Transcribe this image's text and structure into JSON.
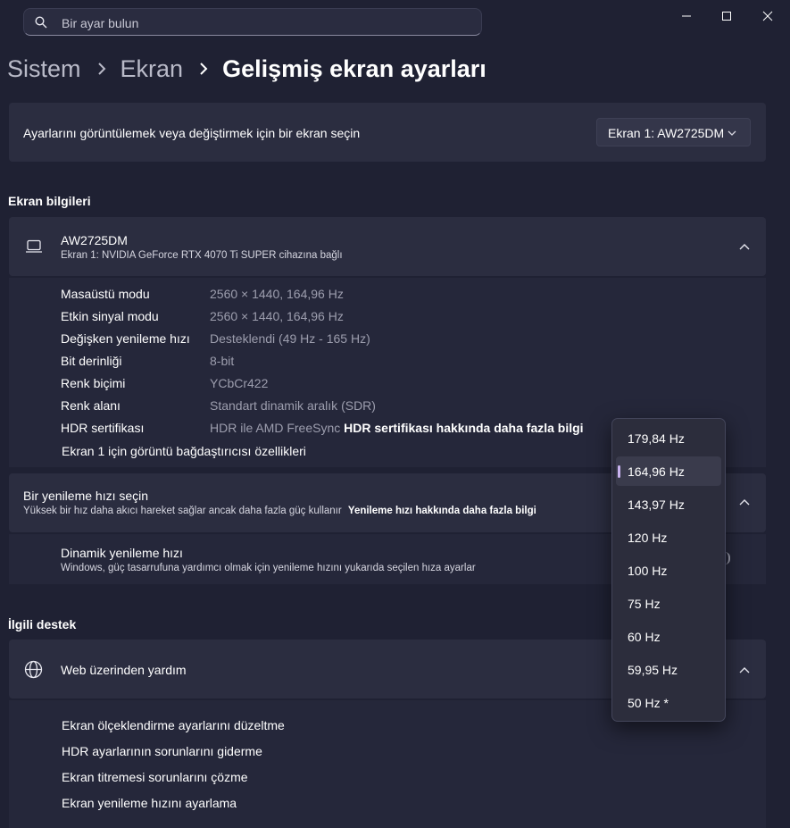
{
  "search": {
    "placeholder": "Bir ayar bulun"
  },
  "breadcrumb": {
    "item1": "Sistem",
    "item2": "Ekran",
    "current": "Gelişmiş ekran ayarları"
  },
  "display_select": {
    "prompt": "Ayarlarını görüntülemek veya değiştirmek için bir ekran seçin",
    "selected": "Ekran 1: AW2725DM"
  },
  "display_info": {
    "section_title": "Ekran bilgileri",
    "monitor_name": "AW2725DM",
    "monitor_sub": "Ekran 1: NVIDIA GeForce RTX 4070 Ti SUPER cihazına bağlı",
    "rows": [
      {
        "label": "Masaüstü modu",
        "value": "2560 × 1440, 164,96 Hz"
      },
      {
        "label": "Etkin sinyal modu",
        "value": "2560 × 1440, 164,96 Hz"
      },
      {
        "label": "Değişken yenileme hızı",
        "value": "Desteklendi (49 Hz - 165 Hz)"
      },
      {
        "label": "Bit derinliği",
        "value": "8-bit"
      },
      {
        "label": "Renk biçimi",
        "value": "YCbCr422"
      },
      {
        "label": "Renk alanı",
        "value": "Standart dinamik aralık (SDR)"
      },
      {
        "label": "HDR sertifikası",
        "value": "HDR ile AMD FreeSync",
        "link": "HDR sertifikası hakkında daha fazla bilgi"
      }
    ],
    "adapter_link": "Ekran 1 için görüntü bağdaştırıcısı özellikleri"
  },
  "refresh": {
    "title": "Bir yenileme hızı seçin",
    "subtitle": "Yüksek bir hız daha akıcı hareket sağlar ancak daha fazla güç kullanır",
    "link": "Yenileme hızı hakkında daha fazla bilgi",
    "dynamic_title": "Dinamik yenileme hızı",
    "dynamic_sub": "Windows, güç tasarrufuna yardımcı olmak için yenileme hızını yukarıda seçilen hıza ayarlar"
  },
  "related": {
    "section_title": "İlgili destek",
    "web_help": "Web üzerinden yardım",
    "links": [
      "Ekran ölçeklendirme ayarlarını düzeltme",
      "HDR ayarlarının sorunlarını giderme",
      "Ekran titremesi sorunlarını çözme",
      "Ekran yenileme hızını ayarlama"
    ]
  },
  "refresh_options": {
    "items": [
      "179,84 Hz",
      "164,96 Hz",
      "143,97 Hz",
      "120 Hz",
      "100 Hz",
      "75 Hz",
      "60 Hz",
      "59,95 Hz",
      "50 Hz *"
    ],
    "selected": "164,96 Hz"
  },
  "icons": {
    "search": "search-icon",
    "minimize": "minimize-icon",
    "maximize": "maximize-icon",
    "close": "close-icon",
    "monitor": "laptop-icon",
    "web": "globe-icon"
  },
  "colors": {
    "background": "#1f2133",
    "card": "#2b2d40",
    "accent": "#c9b3f0"
  }
}
